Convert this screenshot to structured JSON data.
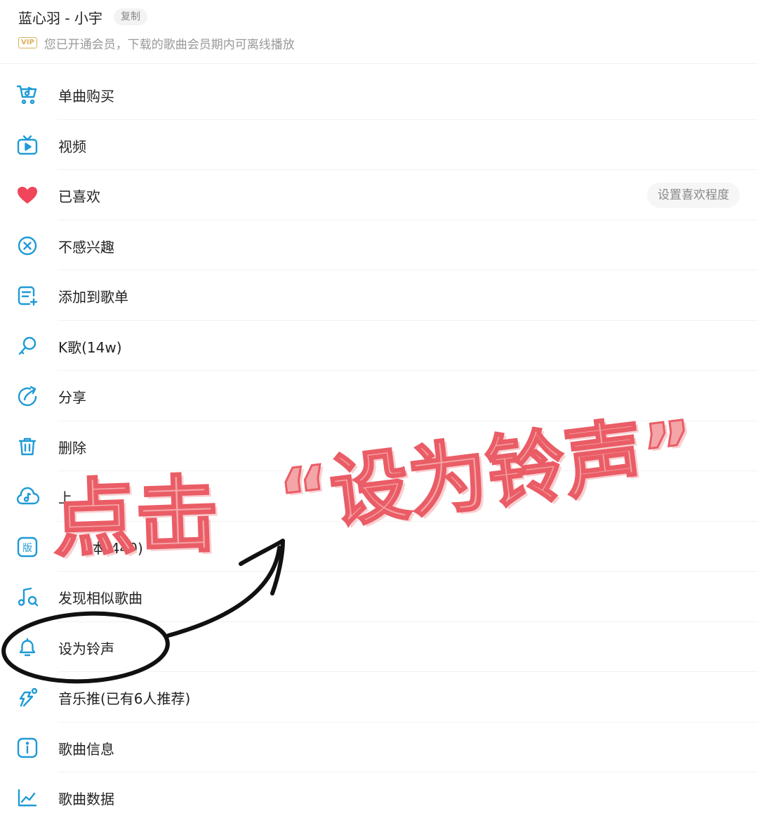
{
  "header": {
    "song_title": "蓝心羽 - 小宇",
    "copy_label": "复制",
    "vip_badge": "VIP",
    "vip_text": "您已开通会员，下载的歌曲会员期内可离线播放"
  },
  "menu": [
    {
      "label": "单曲购买",
      "icon": "cart-music-icon"
    },
    {
      "label": "视频",
      "icon": "tv-play-icon"
    },
    {
      "label": "已喜欢",
      "icon": "heart-icon",
      "action": "设置喜欢程度"
    },
    {
      "label": "不感兴趣",
      "icon": "circle-x-icon"
    },
    {
      "label": "添加到歌单",
      "icon": "playlist-add-icon"
    },
    {
      "label": "K歌(14w)",
      "icon": "microphone-icon"
    },
    {
      "label": "分享",
      "icon": "share-icon"
    },
    {
      "label": "删除",
      "icon": "trash-icon"
    },
    {
      "label": "上",
      "icon": "cloud-music-icon"
    },
    {
      "label": "其他歌手版本(440)",
      "icon": "version-icon",
      "visible_label": "本(440)"
    },
    {
      "label": "发现相似歌曲",
      "icon": "music-search-icon"
    },
    {
      "label": "设为铃声",
      "icon": "bell-icon"
    },
    {
      "label": "音乐推(已有6人推荐)",
      "icon": "recommend-icon"
    },
    {
      "label": "歌曲信息",
      "icon": "info-icon"
    },
    {
      "label": "歌曲数据",
      "icon": "chart-icon"
    }
  ],
  "annotation": {
    "text_1": "点击",
    "text_2": "“设为铃声”"
  },
  "colors": {
    "accent": "#1e9ad6",
    "heart": "#f0455a",
    "annotation_fill": "#f4a5a8",
    "annotation_stroke": "#ea5d66"
  }
}
